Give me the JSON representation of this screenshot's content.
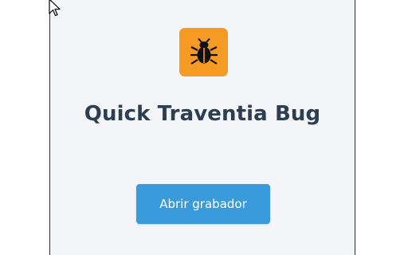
{
  "popup": {
    "logo_icon": "bug-icon",
    "title": "Quick Traventia Bug",
    "button_label": "Abrir grabador"
  },
  "colors": {
    "logo_bg": "#f59a23",
    "title": "#2c3e50",
    "button_bg": "#3a9bdc",
    "popup_bg": "#f4f5f9"
  }
}
